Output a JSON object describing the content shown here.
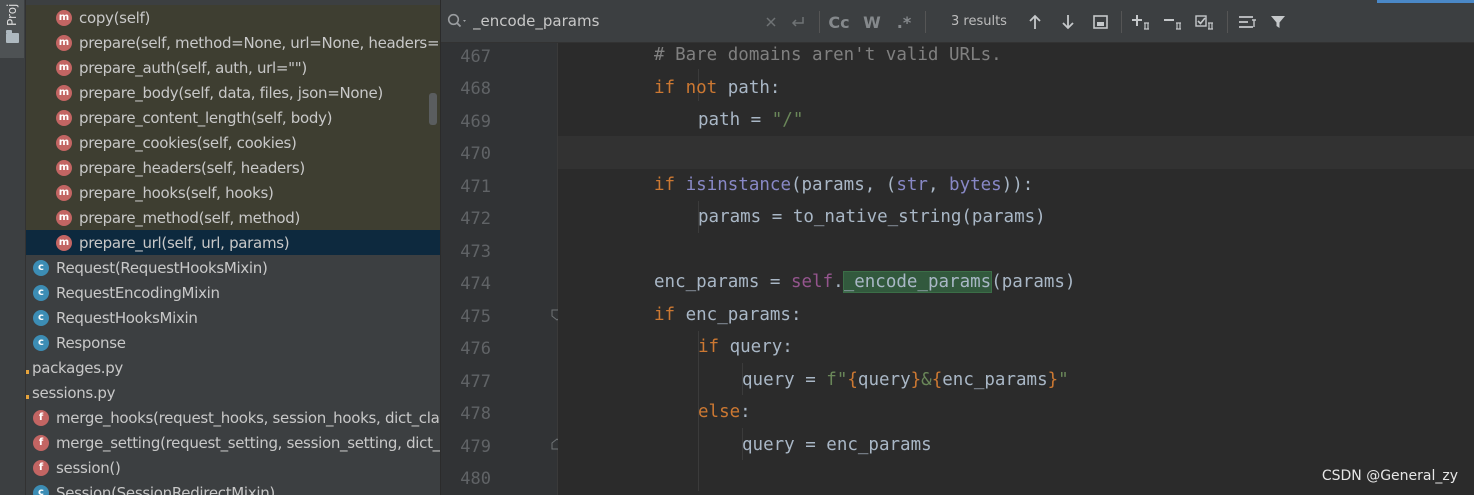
{
  "tool_window": {
    "tab_label": "Proj"
  },
  "structure": {
    "items": [
      {
        "icon": "m",
        "label": "copy(self)"
      },
      {
        "icon": "m",
        "label": "prepare(self, method=None, url=None, headers=N"
      },
      {
        "icon": "m",
        "label": "prepare_auth(self, auth, url=\"\")"
      },
      {
        "icon": "m",
        "label": "prepare_body(self, data, files, json=None)"
      },
      {
        "icon": "m",
        "label": "prepare_content_length(self, body)"
      },
      {
        "icon": "m",
        "label": "prepare_cookies(self, cookies)"
      },
      {
        "icon": "m",
        "label": "prepare_headers(self, headers)"
      },
      {
        "icon": "m",
        "label": "prepare_hooks(self, hooks)"
      },
      {
        "icon": "m",
        "label": "prepare_method(self, method)"
      },
      {
        "icon": "m",
        "label": "prepare_url(self, url, params)"
      },
      {
        "icon": "c",
        "label": "Request(RequestHooksMixin)"
      },
      {
        "icon": "c",
        "label": "RequestEncodingMixin"
      },
      {
        "icon": "c",
        "label": "RequestHooksMixin"
      },
      {
        "icon": "c",
        "label": "Response"
      },
      {
        "icon": "file",
        "label": "packages.py"
      },
      {
        "icon": "file",
        "label": "sessions.py"
      },
      {
        "icon": "f",
        "label": "merge_hooks(request_hooks, session_hooks, dict_cla"
      },
      {
        "icon": "f",
        "label": "merge_setting(request_setting, session_setting, dict_"
      },
      {
        "icon": "f",
        "label": "session()"
      },
      {
        "icon": "c",
        "label": "Session(SessionRedirectMixin)"
      }
    ]
  },
  "find": {
    "query": "_encode_params",
    "results": "3 results",
    "cc_label": "Cc",
    "w_label": "W",
    "regex_label": ".*"
  },
  "editor": {
    "line_numbers": [
      "467",
      "468",
      "469",
      "470",
      "471",
      "472",
      "473",
      "474",
      "475",
      "476",
      "477",
      "478",
      "479",
      "480"
    ],
    "lines": [
      "# Bare domains aren't valid URLs.",
      "if not path:",
      "path = \"/\"",
      "",
      "if isinstance(params, (str, bytes)):",
      "params = to_native_string(params)",
      "",
      "enc_params = self._encode_params(params)",
      "if enc_params:",
      "if query:",
      "query = f\"{query}&{enc_params}\"",
      "else:",
      "query = enc_params",
      ""
    ]
  },
  "watermark": "CSDN @General_zy",
  "colors": {
    "keyword": "#cc7832",
    "comment": "#808080",
    "string": "#6a8759",
    "builtin": "#8888c6",
    "self": "#94558d",
    "match": "#32593d",
    "selection": "#0d293e"
  }
}
